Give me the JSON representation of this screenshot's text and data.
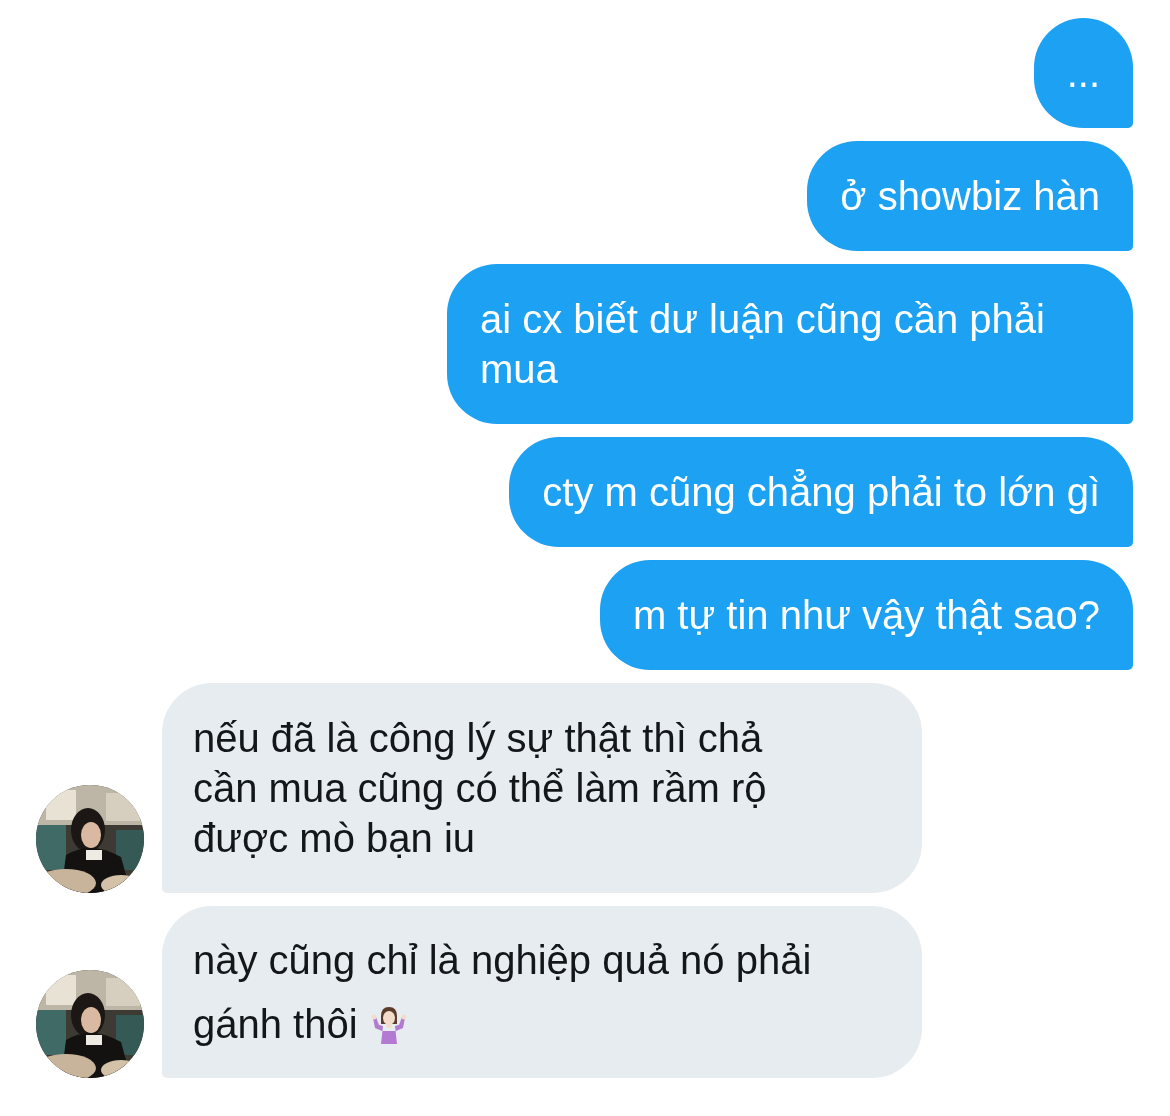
{
  "messages": [
    {
      "kind": "sent",
      "text": "..."
    },
    {
      "kind": "sent",
      "text": "ở showbiz hàn"
    },
    {
      "kind": "sent",
      "text": "ai cx biết dư luận cũng cần phải mua"
    },
    {
      "kind": "sent",
      "text": "cty m cũng chẳng phải to lớn gì"
    },
    {
      "kind": "sent",
      "text": "m tự tin như vậy thật sao?"
    },
    {
      "kind": "received",
      "text": "nếu đã là công lý sự thật thì chả cần mua cũng có thể làm rầm rộ được mò bạn iu"
    },
    {
      "kind": "received",
      "text": "này cũng chỉ là nghiệp quả nó phải gánh thôi",
      "emoji": true
    }
  ]
}
